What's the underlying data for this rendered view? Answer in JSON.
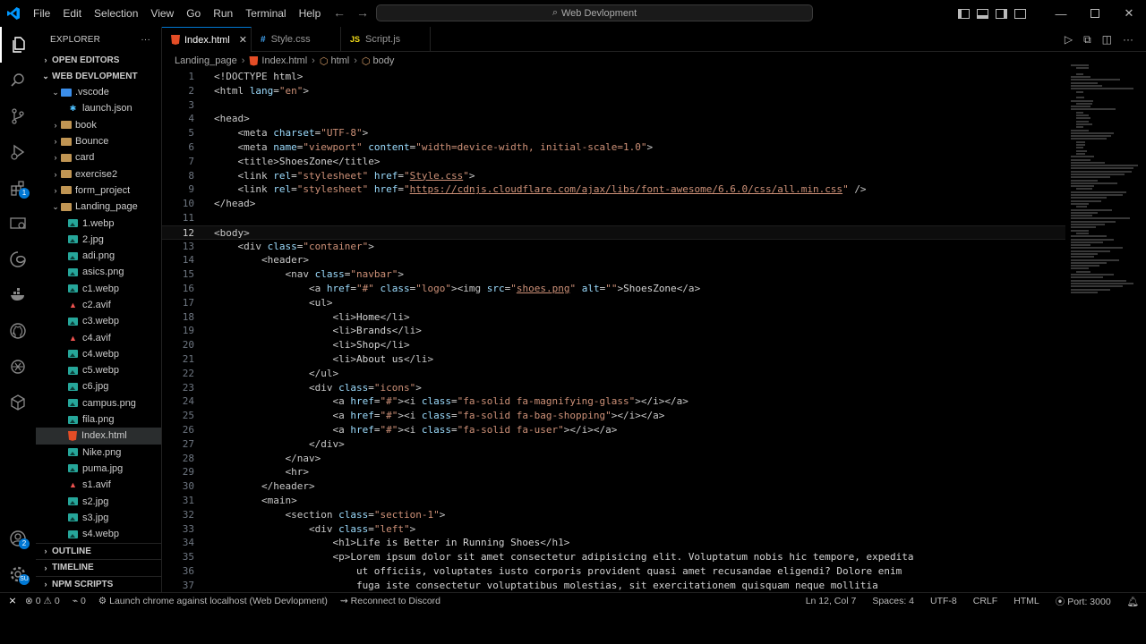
{
  "titlebar": {
    "menu": [
      "File",
      "Edit",
      "Selection",
      "View",
      "Go",
      "Run",
      "Terminal",
      "Help"
    ],
    "search_text": "Web Devlopment"
  },
  "sidebar": {
    "title": "EXPLORER",
    "more": "···",
    "open_editors": "OPEN EDITORS",
    "workspace": "WEB DEVLOPMENT",
    "tree": [
      {
        "label": ".vscode",
        "type": "folder-open",
        "depth": 1
      },
      {
        "label": "launch.json",
        "type": "json",
        "depth": 2
      },
      {
        "label": "book",
        "type": "folder",
        "depth": 1
      },
      {
        "label": "Bounce",
        "type": "folder",
        "depth": 1
      },
      {
        "label": "card",
        "type": "folder",
        "depth": 1
      },
      {
        "label": "exercise2",
        "type": "folder",
        "depth": 1
      },
      {
        "label": "form_project",
        "type": "folder",
        "depth": 1
      },
      {
        "label": "Landing_page",
        "type": "folder-open",
        "depth": 1
      },
      {
        "label": "1.webp",
        "type": "image",
        "depth": 2
      },
      {
        "label": "2.jpg",
        "type": "image",
        "depth": 2
      },
      {
        "label": "adi.png",
        "type": "image",
        "depth": 2
      },
      {
        "label": "asics.png",
        "type": "image",
        "depth": 2
      },
      {
        "label": "c1.webp",
        "type": "image",
        "depth": 2
      },
      {
        "label": "c2.avif",
        "type": "avif",
        "depth": 2
      },
      {
        "label": "c3.webp",
        "type": "image",
        "depth": 2
      },
      {
        "label": "c4.avif",
        "type": "avif",
        "depth": 2
      },
      {
        "label": "c4.webp",
        "type": "image",
        "depth": 2
      },
      {
        "label": "c5.webp",
        "type": "image",
        "depth": 2
      },
      {
        "label": "c6.jpg",
        "type": "image",
        "depth": 2
      },
      {
        "label": "campus.png",
        "type": "image",
        "depth": 2
      },
      {
        "label": "fila.png",
        "type": "image",
        "depth": 2
      },
      {
        "label": "Index.html",
        "type": "html",
        "depth": 2,
        "selected": true
      },
      {
        "label": "Nike.png",
        "type": "image",
        "depth": 2
      },
      {
        "label": "puma.jpg",
        "type": "image",
        "depth": 2
      },
      {
        "label": "s1.avif",
        "type": "avif",
        "depth": 2
      },
      {
        "label": "s2.jpg",
        "type": "image",
        "depth": 2
      },
      {
        "label": "s3.jpg",
        "type": "image",
        "depth": 2
      },
      {
        "label": "s4.webp",
        "type": "image",
        "depth": 2
      }
    ],
    "outline": "OUTLINE",
    "timeline": "TIMELINE",
    "npm_scripts": "NPM SCRIPTS"
  },
  "activity": {
    "extensions_badge": "1",
    "accounts_badge": "2",
    "manage_badge": "SU"
  },
  "tabs": [
    {
      "label": "Index.html",
      "icon": "html",
      "active": true
    },
    {
      "label": "Style.css",
      "icon": "css",
      "active": false
    },
    {
      "label": "Script.js",
      "icon": "js",
      "active": false
    }
  ],
  "breadcrumb": [
    "Landing_page",
    "Index.html",
    "html",
    "body"
  ],
  "editor": {
    "current_line": 12,
    "lines": [
      "<!DOCTYPE html>",
      "<html lang=\"en\">",
      "",
      "<head>",
      "    <meta charset=\"UTF-8\">",
      "    <meta name=\"viewport\" content=\"width=device-width, initial-scale=1.0\">",
      "    <title>ShoesZone</title>",
      "    <link rel=\"stylesheet\" href=\"Style.css\">",
      "    <link rel=\"stylesheet\" href=\"https://cdnjs.cloudflare.com/ajax/libs/font-awesome/6.6.0/css/all.min.css\" />",
      "</head>",
      "",
      "<body>",
      "    <div class=\"container\">",
      "        <header>",
      "            <nav class=\"navbar\">",
      "                <a href=\"#\" class=\"logo\"><img src=\"shoes.png\" alt=\"\">ShoesZone</a>",
      "                <ul>",
      "                    <li>Home</li>",
      "                    <li>Brands</li>",
      "                    <li>Shop</li>",
      "                    <li>About us</li>",
      "                </ul>",
      "                <div class=\"icons\">",
      "                    <a href=\"#\"><i class=\"fa-solid fa-magnifying-glass\"></i></a>",
      "                    <a href=\"#\"><i class=\"fa-solid fa-bag-shopping\"></i></a>",
      "                    <a href=\"#\"><i class=\"fa-solid fa-user\"></i></a>",
      "                </div>",
      "            </nav>",
      "            <hr>",
      "        </header>",
      "        <main>",
      "            <section class=\"section-1\">",
      "                <div class=\"left\">",
      "                    <h1>Life is Better in Running Shoes</h1>",
      "                    <p>Lorem ipsum dolor sit amet consectetur adipisicing elit. Voluptatum nobis hic tempore, expedita",
      "                        ut officiis, voluptates iusto corporis provident quasi amet recusandae eligendi? Dolore enim",
      "                        fuga iste consectetur voluptatibus molestias, sit exercitationem quisquam neque mollitia"
    ]
  },
  "statusbar": {
    "errors": "0",
    "warnings": "0",
    "ports": "0",
    "launch": "Launch chrome against localhost (Web Devlopment)",
    "discord": "Reconnect to Discord",
    "position": "Ln 12, Col 7",
    "spaces": "Spaces: 4",
    "encoding": "UTF-8",
    "eol": "CRLF",
    "language": "HTML",
    "port": "Port: 3000"
  }
}
